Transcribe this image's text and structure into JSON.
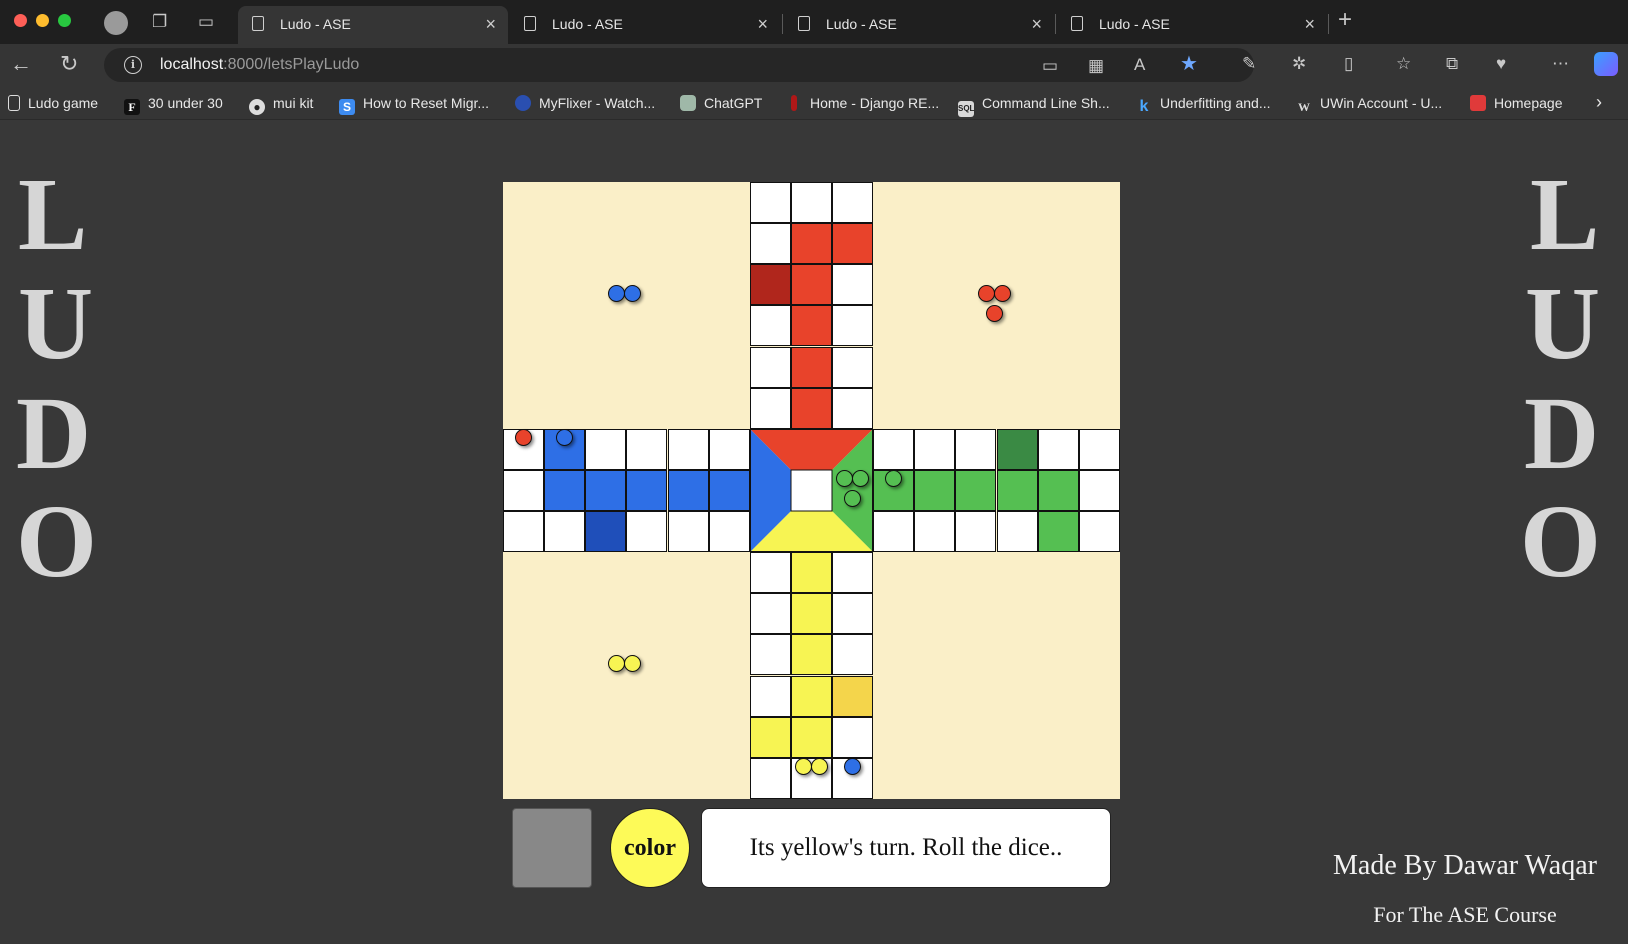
{
  "browser": {
    "tabs": [
      {
        "title": "Ludo - ASE",
        "active": true
      },
      {
        "title": "Ludo - ASE",
        "active": false
      },
      {
        "title": "Ludo - ASE",
        "active": false
      },
      {
        "title": "Ludo - ASE",
        "active": false
      }
    ],
    "url_host": "localhost",
    "url_path": ":8000/letsPlayLudo",
    "bookmarks": [
      {
        "label": "Ludo game",
        "icon": "document-icon"
      },
      {
        "label": "30 under 30",
        "icon": "forbes-icon"
      },
      {
        "label": "mui kit",
        "icon": "github-icon"
      },
      {
        "label": "How to Reset Migr...",
        "icon": "s-site-icon"
      },
      {
        "label": "MyFlixer - Watch...",
        "icon": "myflixer-icon"
      },
      {
        "label": "ChatGPT",
        "icon": "chatgpt-icon"
      },
      {
        "label": "Home - Django RE...",
        "icon": "django-icon"
      },
      {
        "label": "Command Line Sh...",
        "icon": "sql-icon"
      },
      {
        "label": "Underfitting and...",
        "icon": "k-site-icon"
      },
      {
        "label": "UWin Account - U...",
        "icon": "uwin-icon"
      },
      {
        "label": "Homepage",
        "icon": "homepage-icon"
      }
    ]
  },
  "page": {
    "side_letters": [
      "L",
      "U",
      "D",
      "O"
    ],
    "color_label": "color",
    "current_color": "#fdfa58",
    "message": "Its yellow's turn. Roll the dice..",
    "credit_line1": "Made By Dawar Waqar",
    "credit_line2": "For The ASE Course"
  },
  "colors": {
    "red": "#e8432b",
    "red_dark": "#b0261c",
    "blue": "#2e6fe6",
    "blue_dark": "#1f4fba",
    "green": "#55bf52",
    "green_dark": "#3a8a44",
    "yellow": "#f7f453",
    "yellow_dark": "#f4d54b",
    "home": "#faefc8"
  },
  "board": {
    "grid_size": 15,
    "cell_colors": [
      {
        "row": 1,
        "col": 7,
        "color": "red"
      },
      {
        "row": 1,
        "col": 8,
        "color": "red"
      },
      {
        "row": 2,
        "col": 6,
        "color": "red_dark"
      },
      {
        "row": 2,
        "col": 7,
        "color": "red"
      },
      {
        "row": 3,
        "col": 7,
        "color": "red"
      },
      {
        "row": 4,
        "col": 7,
        "color": "red"
      },
      {
        "row": 5,
        "col": 7,
        "color": "red"
      },
      {
        "row": 6,
        "col": 1,
        "color": "blue"
      },
      {
        "row": 7,
        "col": 1,
        "color": "blue"
      },
      {
        "row": 7,
        "col": 2,
        "color": "blue"
      },
      {
        "row": 7,
        "col": 3,
        "color": "blue"
      },
      {
        "row": 7,
        "col": 4,
        "color": "blue"
      },
      {
        "row": 7,
        "col": 5,
        "color": "blue"
      },
      {
        "row": 8,
        "col": 2,
        "color": "blue_dark"
      },
      {
        "row": 6,
        "col": 12,
        "color": "green_dark"
      },
      {
        "row": 7,
        "col": 9,
        "color": "green"
      },
      {
        "row": 7,
        "col": 10,
        "color": "green"
      },
      {
        "row": 7,
        "col": 11,
        "color": "green"
      },
      {
        "row": 7,
        "col": 12,
        "color": "green"
      },
      {
        "row": 7,
        "col": 13,
        "color": "green"
      },
      {
        "row": 8,
        "col": 13,
        "color": "green"
      },
      {
        "row": 9,
        "col": 7,
        "color": "yellow"
      },
      {
        "row": 10,
        "col": 7,
        "color": "yellow"
      },
      {
        "row": 11,
        "col": 7,
        "color": "yellow"
      },
      {
        "row": 12,
        "col": 7,
        "color": "yellow"
      },
      {
        "row": 12,
        "col": 8,
        "color": "yellow_dark"
      },
      {
        "row": 13,
        "col": 6,
        "color": "yellow"
      },
      {
        "row": 13,
        "col": 7,
        "color": "yellow"
      }
    ],
    "pawns": [
      {
        "color": "blue",
        "row": 2.7,
        "col": 2.75
      },
      {
        "color": "blue",
        "row": 2.7,
        "col": 3.15
      },
      {
        "color": "red",
        "row": 2.7,
        "col": 11.75
      },
      {
        "color": "red",
        "row": 2.7,
        "col": 12.15
      },
      {
        "color": "red",
        "row": 3.2,
        "col": 11.95
      },
      {
        "color": "red",
        "row": 6.2,
        "col": 0.5
      },
      {
        "color": "blue",
        "row": 6.2,
        "col": 1.5
      },
      {
        "color": "green",
        "row": 7.2,
        "col": 8.3
      },
      {
        "color": "green",
        "row": 7.2,
        "col": 8.7
      },
      {
        "color": "green",
        "row": 7.7,
        "col": 8.5
      },
      {
        "color": "green",
        "row": 7.2,
        "col": 9.5
      },
      {
        "color": "yellow",
        "row": 11.7,
        "col": 2.75
      },
      {
        "color": "yellow",
        "row": 11.7,
        "col": 3.15
      },
      {
        "color": "yellow",
        "row": 14.2,
        "col": 7.3
      },
      {
        "color": "yellow",
        "row": 14.2,
        "col": 7.7
      },
      {
        "color": "blue",
        "row": 14.2,
        "col": 8.5
      }
    ]
  }
}
